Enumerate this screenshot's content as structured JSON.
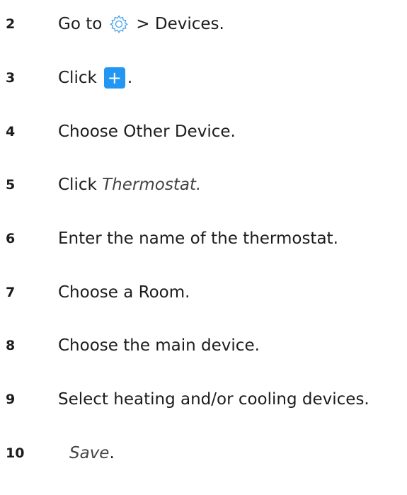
{
  "steps": [
    {
      "number": "2",
      "before": "Go to",
      "icon": "gear-icon",
      "after": "> Devices."
    },
    {
      "number": "3",
      "before": "Click",
      "icon": "plus-button",
      "after": "."
    },
    {
      "number": "4",
      "text": "Choose Other Device."
    },
    {
      "number": "5",
      "before": "Click",
      "italic": "Thermostat."
    },
    {
      "number": "6",
      "text": "Enter the name of the thermostat."
    },
    {
      "number": "7",
      "text": "Choose a Room."
    },
    {
      "number": "8",
      "text": "Choose the main device."
    },
    {
      "number": "9",
      "text": "Select heating and/or cooling devices."
    },
    {
      "number": "10",
      "italic": "Save",
      "after": "."
    }
  ],
  "plus_symbol": "+",
  "colors": {
    "accent": "#2196f3",
    "gear_stroke": "#3a9be8"
  }
}
